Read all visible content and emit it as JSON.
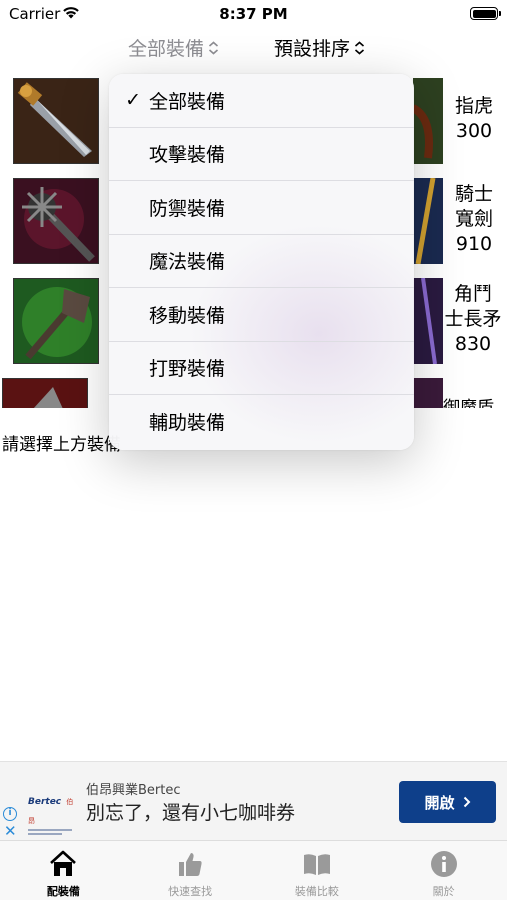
{
  "status_bar": {
    "carrier": "Carrier",
    "time": "8:37 PM"
  },
  "filter_bar": {
    "category_label": "全部裝備",
    "sort_label": "預設排序"
  },
  "items": [
    {
      "name_line1": "指虎",
      "name_line2": "",
      "price": "300",
      "icon": "dagger-icon"
    },
    {
      "name_line1": "騎士",
      "name_line2": "寬劍",
      "price": "910",
      "icon": "spiked-mace-icon"
    },
    {
      "name_line1": "角鬥",
      "name_line2": "士長矛",
      "price": "830",
      "icon": "green-axe-icon"
    },
    {
      "name_line1": "御魔盾",
      "name_line2": "",
      "price": "",
      "icon": "red-blade-icon"
    }
  ],
  "hint": "請選擇上方裝備",
  "dropdown": {
    "items": [
      {
        "label": "全部裝備",
        "checked": true
      },
      {
        "label": "攻擊裝備",
        "checked": false
      },
      {
        "label": "防禦裝備",
        "checked": false
      },
      {
        "label": "魔法裝備",
        "checked": false
      },
      {
        "label": "移動裝備",
        "checked": false
      },
      {
        "label": "打野裝備",
        "checked": false
      },
      {
        "label": "輔助裝備",
        "checked": false
      }
    ],
    "check_glyph": "✓"
  },
  "ad": {
    "logo_text": "Bertec",
    "logo_sub": "伯昂",
    "advertiser": "伯昂興業Bertec",
    "headline": "別忘了，還有小七咖啡券",
    "cta": "開啟",
    "cta_color": "#0e3f8a",
    "info_glyph": "i",
    "close_glyph": "✕"
  },
  "tab_bar": {
    "tabs": [
      {
        "label": "配裝備",
        "icon": "home-icon",
        "active": true
      },
      {
        "label": "快速查找",
        "icon": "thumbs-up-icon",
        "active": false
      },
      {
        "label": "裝備比較",
        "icon": "open-book-icon",
        "active": false
      },
      {
        "label": "關於",
        "icon": "info-icon",
        "active": false
      }
    ]
  }
}
